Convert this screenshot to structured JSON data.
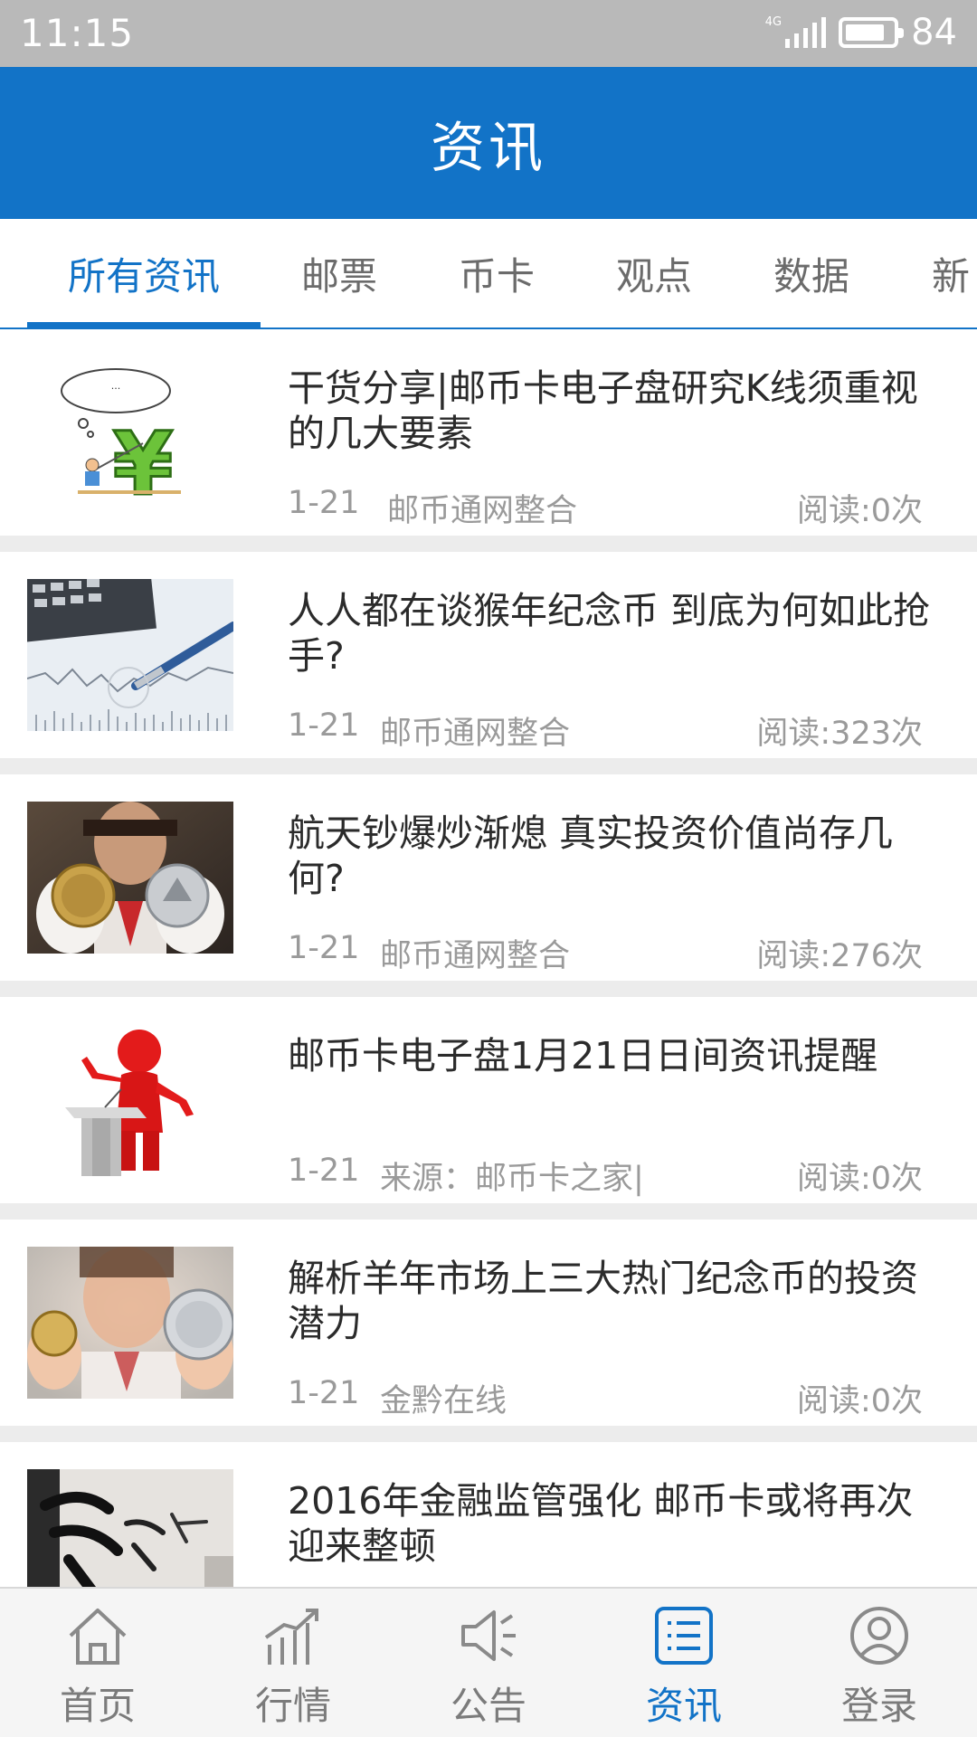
{
  "status_bar": {
    "time": "11:15",
    "network": "4G",
    "battery": "84",
    "battery_level": 0.84
  },
  "header": {
    "title": "资讯"
  },
  "tabs": [
    {
      "label": "所有资讯",
      "active": true
    },
    {
      "label": "邮票",
      "active": false
    },
    {
      "label": "币卡",
      "active": false
    },
    {
      "label": "观点",
      "active": false
    },
    {
      "label": "数据",
      "active": false
    },
    {
      "label": "新",
      "active": false
    }
  ],
  "news": [
    {
      "title": "干货分享|邮币卡电子盘研究K线须重视的几大要素",
      "date": "1-21",
      "source": "邮币通网整合",
      "reads": "阅读:0次",
      "thumb": "cartoon-yuan-icon"
    },
    {
      "title": "人人都在谈猴年纪念币 到底为何如此抢手?",
      "date": "1-21",
      "source": "邮币通网整合",
      "reads": "阅读:323次",
      "thumb": "calculator-pen-chart"
    },
    {
      "title": "航天钞爆炒渐熄 真实投资价值尚存几何?",
      "date": "1-21",
      "source": "邮币通网整合",
      "reads": "阅读:276次",
      "thumb": "coins-held"
    },
    {
      "title": "邮币卡电子盘1月21日日间资讯提醒",
      "date": "1-21",
      "source": "来源：邮币卡之家|",
      "reads": "阅读:0次",
      "thumb": "red-figure-podium"
    },
    {
      "title": "解析羊年市场上三大热门纪念币的投资潜力",
      "date": "1-21",
      "source": "金黔在线",
      "reads": "阅读:0次",
      "thumb": "woman-coins"
    },
    {
      "title": "2016年金融监管强化 邮币卡或将再次迎来整顿",
      "date": "",
      "source": "",
      "reads": "",
      "thumb": "calligraphy-art"
    }
  ],
  "bottom_nav": [
    {
      "label": "首页",
      "icon": "home-icon",
      "active": false
    },
    {
      "label": "行情",
      "icon": "market-chart-icon",
      "active": false
    },
    {
      "label": "公告",
      "icon": "megaphone-icon",
      "active": false
    },
    {
      "label": "资讯",
      "icon": "news-list-icon",
      "active": true
    },
    {
      "label": "登录",
      "icon": "user-icon",
      "active": false
    }
  ],
  "colors": {
    "primary": "#1273c7",
    "status_bar": "#b9b9b9",
    "text": "#2b2b2b",
    "muted": "#9a9a9a"
  }
}
